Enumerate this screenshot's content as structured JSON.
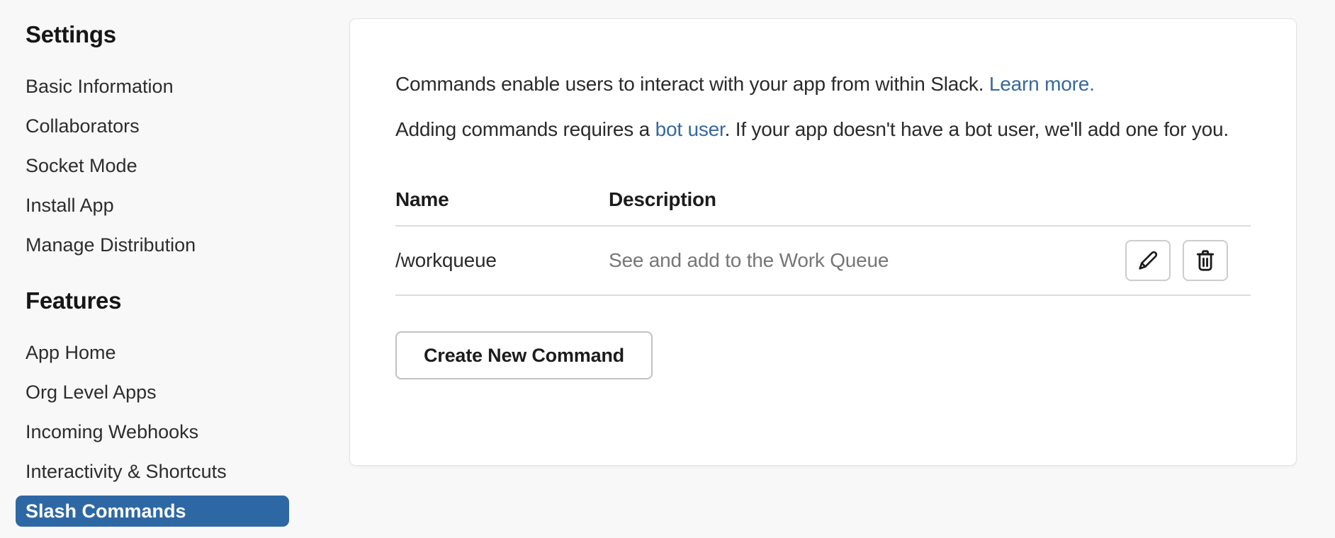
{
  "sidebar": {
    "sections": [
      {
        "heading": "Settings",
        "items": [
          {
            "label": "Basic Information"
          },
          {
            "label": "Collaborators"
          },
          {
            "label": "Socket Mode"
          },
          {
            "label": "Install App"
          },
          {
            "label": "Manage Distribution"
          }
        ]
      },
      {
        "heading": "Features",
        "items": [
          {
            "label": "App Home"
          },
          {
            "label": "Org Level Apps"
          },
          {
            "label": "Incoming Webhooks"
          },
          {
            "label": "Interactivity & Shortcuts"
          },
          {
            "label": "Slash Commands",
            "active": true
          }
        ]
      }
    ]
  },
  "main": {
    "intro": {
      "p1_text": "Commands enable users to interact with your app from within Slack.",
      "p1_link": "Learn more.",
      "p2_pre": "Adding commands requires a ",
      "p2_link": "bot user",
      "p2_post": ". If your app doesn't have a bot user, we'll add one for you."
    },
    "table": {
      "columns": [
        "Name",
        "Description"
      ],
      "rows": [
        {
          "name": "/workqueue",
          "description": "See and add to the Work Queue"
        }
      ]
    },
    "create_button": "Create New Command",
    "icons": {
      "edit": "pencil-icon",
      "delete": "trash-icon"
    }
  },
  "colors": {
    "page_background": "#f8f8f8",
    "card_background": "#ffffff",
    "active_item_background": "#2e68a4",
    "active_item_text": "#ffffff",
    "link": "#36699e",
    "text_dark": "#1d1c1d",
    "text_muted": "#767676",
    "divider": "#dcdcdc"
  }
}
